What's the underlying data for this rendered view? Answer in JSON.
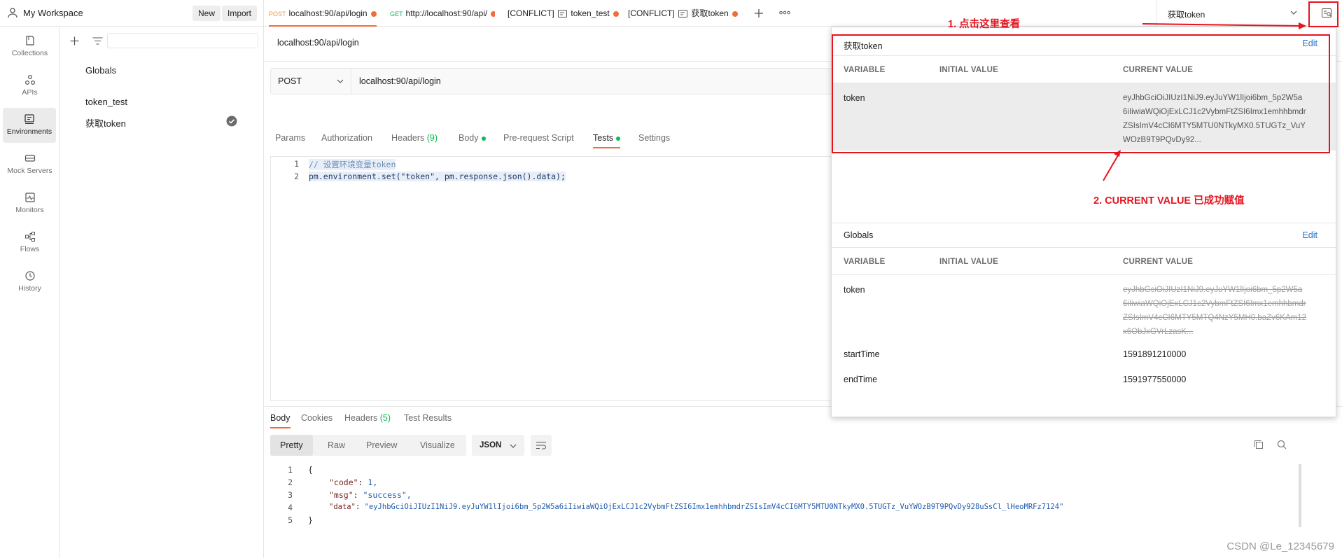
{
  "workspace": {
    "title": "My Workspace",
    "new_label": "New",
    "import_label": "Import"
  },
  "tabs": [
    {
      "method": "POST",
      "label": "localhost:90/api/login"
    },
    {
      "method": "GET",
      "label": "http://localhost:90/api/"
    },
    {
      "prefix": "[CONFLICT]",
      "label": "token_test"
    },
    {
      "prefix": "[CONFLICT]",
      "label": "获取token"
    }
  ],
  "env_selector": {
    "selected": "获取token"
  },
  "sidebar": {
    "items": [
      {
        "label": "Collections"
      },
      {
        "label": "APIs"
      },
      {
        "label": "Environments"
      },
      {
        "label": "Mock Servers"
      },
      {
        "label": "Monitors"
      },
      {
        "label": "Flows"
      },
      {
        "label": "History"
      }
    ]
  },
  "envlist": {
    "globals": "Globals",
    "items": [
      "token_test",
      "获取token"
    ]
  },
  "request": {
    "title": "localhost:90/api/login",
    "method": "POST",
    "url": "localhost:90/api/login",
    "tabs": [
      "Params",
      "Authorization",
      "Headers",
      "(9)",
      "Body",
      "Pre-request Script",
      "Tests",
      "Settings"
    ]
  },
  "tests_code": [
    {
      "n": "1",
      "text": "// 设置环境变量token"
    },
    {
      "n": "2",
      "text": "pm.environment.set(\"token\", pm.response.json().data);"
    }
  ],
  "response": {
    "tabs": [
      "Body",
      "Cookies",
      "Headers",
      "(5)",
      "Test Results"
    ],
    "views": [
      "Pretty",
      "Raw",
      "Preview",
      "Visualize"
    ],
    "format": "JSON",
    "lines": [
      {
        "n": "1",
        "text": "{"
      },
      {
        "n": "2",
        "key": "\"code\"",
        "val": "1,"
      },
      {
        "n": "3",
        "key": "\"msg\"",
        "val": "\"success\","
      },
      {
        "n": "4",
        "key": "\"data\"",
        "val": "\"eyJhbGciOiJIUzI1NiJ9.eyJuYW1lIjoi6bm_5p2W5a6iIiwiaWQiOjExLCJ1c2VybmFtZSI6Imx1emhhbmdrZSIsImV4cCI6MTY5MTU0NTkyMX0.5TUGTz_VuYWOzB9T9PQvDy928uSsCl_lHeoMRFz7124\""
      },
      {
        "n": "5",
        "text": "}"
      }
    ]
  },
  "popup": {
    "env": {
      "name": "获取token",
      "edit": "Edit",
      "headers": [
        "VARIABLE",
        "INITIAL VALUE",
        "CURRENT VALUE"
      ],
      "rows": [
        {
          "variable": "token",
          "initial": "",
          "current": "eyJhbGciOiJIUzI1NiJ9.eyJuYW1lIjoi6bm_5p2W5a6iIiwiaWQiOjExLCJ1c2VybmFtZSI6Imx1emhhbmdrZSIsImV4cCI6MTY5MTU0NTkyMX0.5TUGTz_VuYWOzB9T9PQvDy92..."
        }
      ]
    },
    "globals": {
      "name": "Globals",
      "edit": "Edit",
      "headers": [
        "VARIABLE",
        "INITIAL VALUE",
        "CURRENT VALUE"
      ],
      "rows": [
        {
          "variable": "token",
          "initial": "",
          "current": "eyJhbGciOiJIUzI1NiJ9.eyJuYW1lIjoi6bm_5p2W5a6iIiwiaWQiOjExLCJ1c2VybmFtZSI6Imx1emhhbmdrZSIsImV4cCI6MTY5MTQ4NzY5MH0.baZv6KAm12x6ObJxGVrLzasK..."
        },
        {
          "variable": "startTime",
          "initial": "",
          "current": "1591891210000"
        },
        {
          "variable": "endTime",
          "initial": "",
          "current": "1591977550000"
        }
      ]
    }
  },
  "annotations": {
    "step1": "1. 点击这里查看",
    "step2": "2. CURRENT VALUE 已成功赋值"
  },
  "watermark": "CSDN @Le_12345679",
  "colors": {
    "accent": "#f26b3a",
    "success": "#0cbb52",
    "link": "#1f6fd1",
    "annotation": "#e5141f"
  }
}
